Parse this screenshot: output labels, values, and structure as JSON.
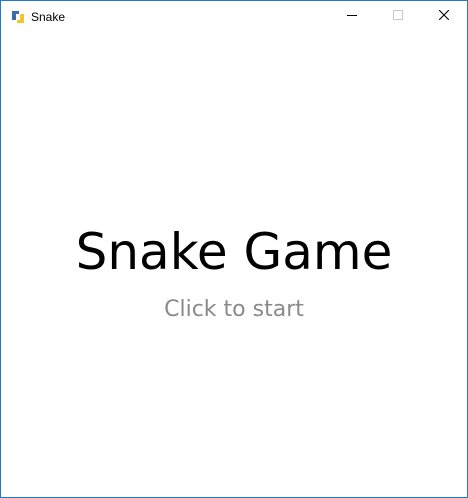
{
  "window": {
    "title": "Snake",
    "border_color": "#1f7bc8",
    "app_icon": "python-icon",
    "controls": {
      "minimize_icon": "minimize-icon",
      "maximize_icon": "maximize-icon",
      "close_icon": "close-icon"
    }
  },
  "game": {
    "title": "Snake Game",
    "subtitle": "Click to start",
    "title_color": "#000000",
    "subtitle_color": "#8a8a8a",
    "background_color": "#ffffff"
  }
}
